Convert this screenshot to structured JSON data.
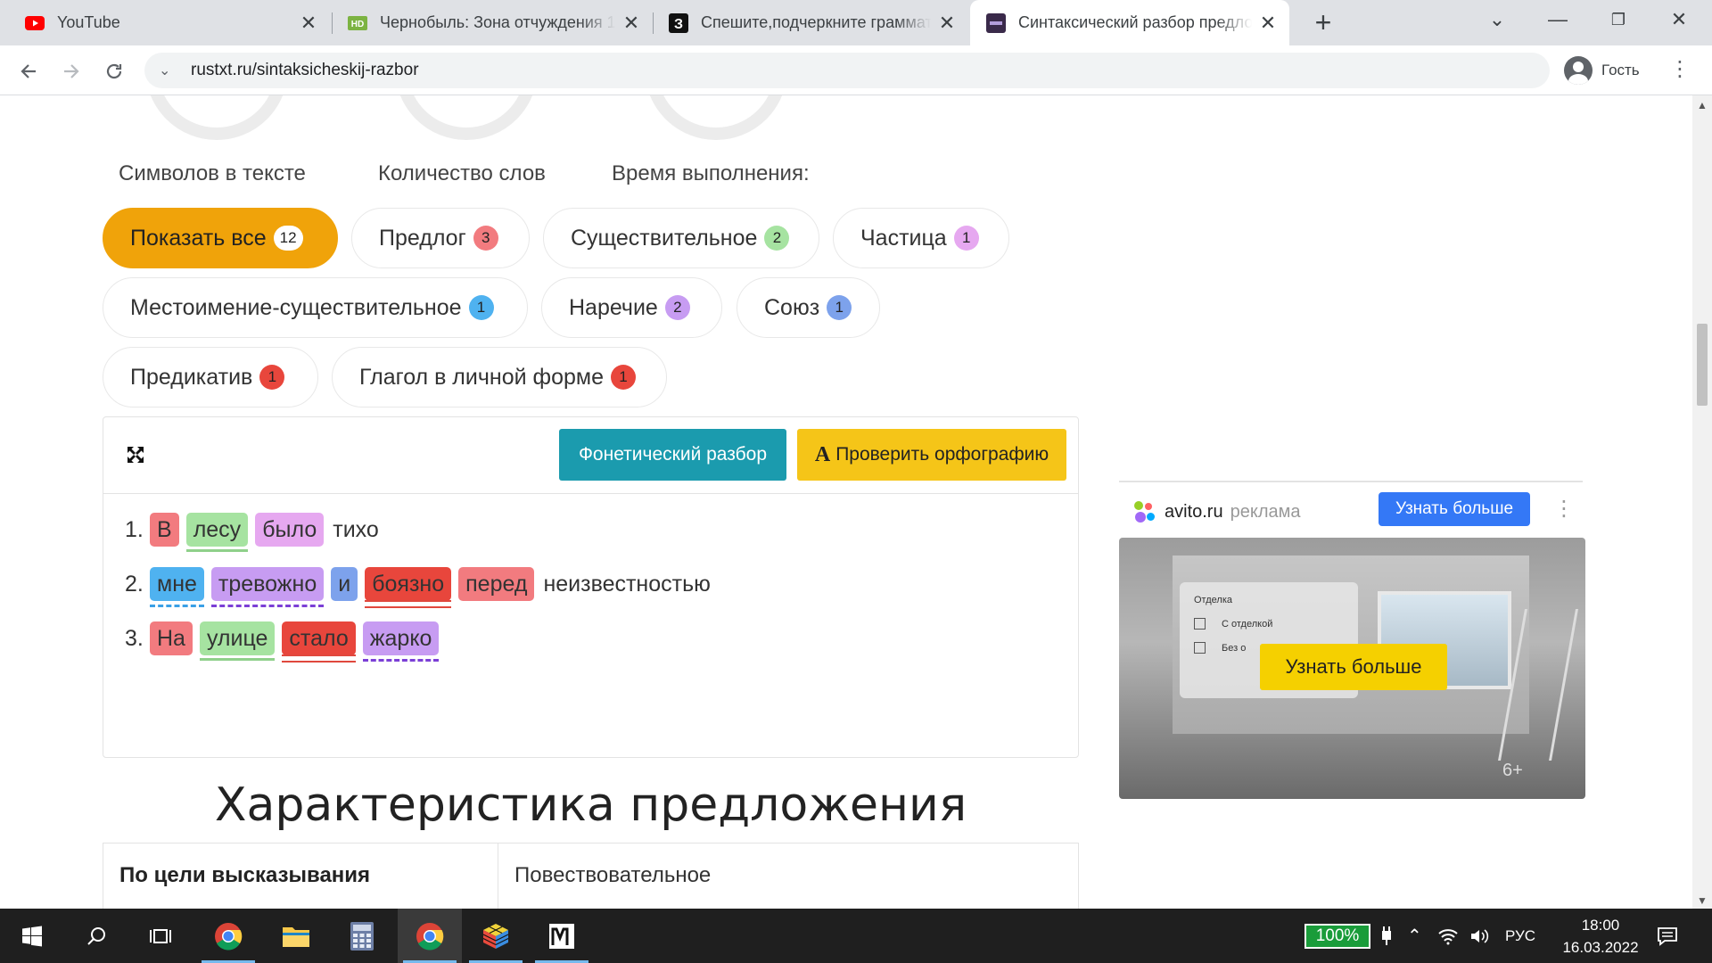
{
  "browser": {
    "tabs": [
      {
        "title": "YouTube",
        "favicon": "youtube-icon"
      },
      {
        "title": "Чернобыль: Зона отчуждения 1",
        "favicon": "hd-icon"
      },
      {
        "title": "Спешите,подчеркните граммати",
        "favicon": "z-icon"
      },
      {
        "title": "Синтаксический разбор предло",
        "favicon": "site-icon",
        "active": true
      }
    ],
    "url": "rustxt.ru/sintaksicheskij-razbor",
    "profile_label": "Гость"
  },
  "stats": {
    "labels": [
      "Символов в тексте",
      "Количество слов",
      "Время выполнения:"
    ]
  },
  "filters": [
    {
      "label": "Показать все",
      "count": "12",
      "color": "#ffffff"
    },
    {
      "label": "Предлог",
      "count": "3",
      "color": "#f27b7f"
    },
    {
      "label": "Существительное",
      "count": "2",
      "color": "#a6e3a1"
    },
    {
      "label": "Частица",
      "count": "1",
      "color": "#e6a8f0"
    },
    {
      "label": "Местоимение-существительное",
      "count": "1",
      "color": "#4fb2f0"
    },
    {
      "label": "Наречие",
      "count": "2",
      "color": "#c79cf2"
    },
    {
      "label": "Союз",
      "count": "1",
      "color": "#7da2ec"
    },
    {
      "label": "Предикатив",
      "count": "1",
      "color": "#e8463c"
    },
    {
      "label": "Глагол в личной форме",
      "count": "1",
      "color": "#e8463c"
    }
  ],
  "panel": {
    "phonetic_button": "Фонетический разбор",
    "spell_button_glyph": "A",
    "spell_button": "Проверить орфографию"
  },
  "sentences": [
    {
      "num": "1.",
      "words": [
        {
          "text": "В",
          "bg": "#f27b7f",
          "ul": ""
        },
        {
          "text": "лесу",
          "bg": "#a6e3a1",
          "ul": "solid"
        },
        {
          "text": "было",
          "bg": "#e6a8f0",
          "ul": ""
        },
        {
          "text": "тихо",
          "bg": "",
          "ul": ""
        }
      ]
    },
    {
      "num": "2.",
      "words": [
        {
          "text": "мне",
          "bg": "#4fb2f0",
          "ul": "dash"
        },
        {
          "text": "тревожно",
          "bg": "#c79cf2",
          "ul": "dashdot"
        },
        {
          "text": "и",
          "bg": "#7da2ec",
          "ul": ""
        },
        {
          "text": "боязно",
          "bg": "#e8463c",
          "ul": "double"
        },
        {
          "text": "перед",
          "bg": "#f27b7f",
          "ul": ""
        },
        {
          "text": "неизвестностью",
          "bg": "",
          "ul": ""
        }
      ]
    },
    {
      "num": "3.",
      "words": [
        {
          "text": "На",
          "bg": "#f27b7f",
          "ul": ""
        },
        {
          "text": "улице",
          "bg": "#a6e3a1",
          "ul": "solid"
        },
        {
          "text": "стало",
          "bg": "#e8463c",
          "ul": "double"
        },
        {
          "text": "жарко",
          "bg": "#c79cf2",
          "ul": "dashdot"
        }
      ]
    }
  ],
  "characteristics": {
    "heading": "Характеристика предложения",
    "rows": [
      {
        "label": "По цели высказывания",
        "value": "Повествовательное"
      }
    ]
  },
  "ad": {
    "site": "avito.ru",
    "tag": "реклама",
    "button": "Узнать больше",
    "image_card_title": "Отделка",
    "image_options": [
      "С отделкой",
      "Без о"
    ],
    "image_cta": "Узнать больше",
    "age": "6+"
  },
  "taskbar": {
    "battery": "100%",
    "lang": "РУС",
    "time": "18:00",
    "date": "16.03.2022"
  },
  "colors": {
    "accent": "#f0a30a",
    "phonetic_btn": "#1b9bae",
    "spell_btn": "#f5c518",
    "ad_btn": "#3478f6"
  }
}
